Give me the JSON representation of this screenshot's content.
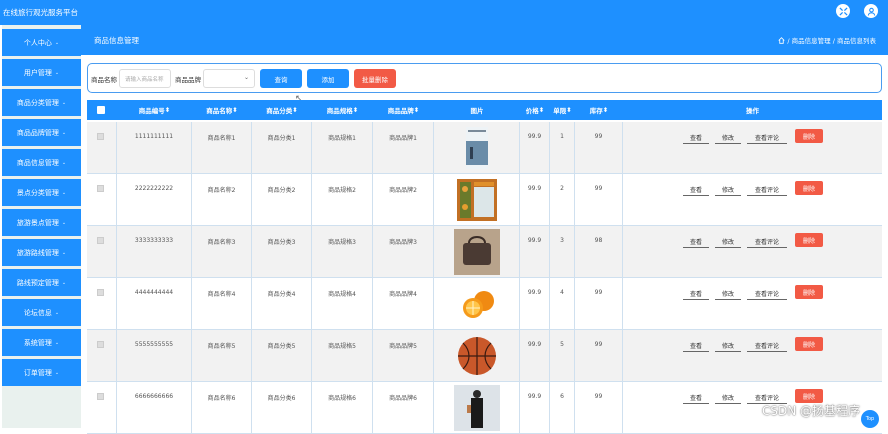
{
  "app": {
    "title": "在线旅行观光服务平台"
  },
  "sidebar": {
    "items": [
      {
        "label": "个人中心"
      },
      {
        "label": "用户管理"
      },
      {
        "label": "商品分类管理"
      },
      {
        "label": "商品品牌管理"
      },
      {
        "label": "商品信息管理"
      },
      {
        "label": "景点分类管理"
      },
      {
        "label": "旅游景点管理"
      },
      {
        "label": "旅游路线管理"
      },
      {
        "label": "路线预定管理"
      },
      {
        "label": "论坛信息"
      },
      {
        "label": "系统管理"
      },
      {
        "label": "订单管理"
      }
    ]
  },
  "header": {
    "page_title": "商品信息管理",
    "breadcrumb": "/ 商品信息管理 / 商品信息列表"
  },
  "search": {
    "name_label": "商品名称",
    "name_placeholder": "请输入商品名称",
    "brand_label": "商品品牌",
    "query_btn": "查询",
    "add_btn": "添加",
    "batch_delete_btn": "批量删除"
  },
  "table": {
    "columns": [
      "商品编号",
      "商品名称",
      "商品分类",
      "商品规格",
      "商品品牌",
      "图片",
      "价格",
      "单限",
      "库存",
      "操作"
    ],
    "rows": [
      {
        "id": "1111111111",
        "name": "商品名称1",
        "category": "商品分类1",
        "spec": "商品规格1",
        "brand": "商品品牌1",
        "price": "99.9",
        "limit": "1",
        "stock": "99"
      },
      {
        "id": "2222222222",
        "name": "商品名称2",
        "category": "商品分类2",
        "spec": "商品规格2",
        "brand": "商品品牌2",
        "price": "99.9",
        "limit": "2",
        "stock": "99"
      },
      {
        "id": "3333333333",
        "name": "商品名称3",
        "category": "商品分类3",
        "spec": "商品规格3",
        "brand": "商品品牌3",
        "price": "99.9",
        "limit": "3",
        "stock": "98"
      },
      {
        "id": "4444444444",
        "name": "商品名称4",
        "category": "商品分类4",
        "spec": "商品规格4",
        "brand": "商品品牌4",
        "price": "99.9",
        "limit": "4",
        "stock": "99"
      },
      {
        "id": "5555555555",
        "name": "商品名称5",
        "category": "商品分类5",
        "spec": "商品规格5",
        "brand": "商品品牌5",
        "price": "99.9",
        "limit": "5",
        "stock": "99"
      },
      {
        "id": "6666666666",
        "name": "商品名称6",
        "category": "商品分类6",
        "spec": "商品规格6",
        "brand": "商品品牌6",
        "price": "99.9",
        "limit": "6",
        "stock": "99"
      }
    ],
    "ops": {
      "view": "查看",
      "edit": "修改",
      "view_comment": "查看评论",
      "delete": "删除"
    }
  },
  "watermark": "CSDN @扬基程序",
  "top_btn": "Top"
}
